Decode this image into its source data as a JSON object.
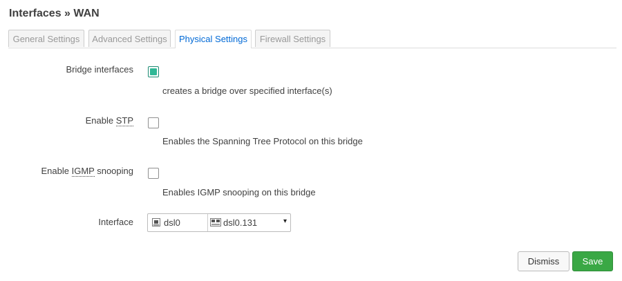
{
  "page": {
    "title": "Interfaces » WAN"
  },
  "tabs": [
    {
      "label": "General Settings",
      "active": false
    },
    {
      "label": "Advanced Settings",
      "active": false
    },
    {
      "label": "Physical Settings",
      "active": true
    },
    {
      "label": "Firewall Settings",
      "active": false
    }
  ],
  "fields": {
    "bridge": {
      "label": "Bridge interfaces",
      "checked": true,
      "description": "creates a bridge over specified interface(s)"
    },
    "stp": {
      "label_prefix": "Enable ",
      "label_abbr": "STP",
      "label_suffix": "",
      "checked": false,
      "description": "Enables the Spanning Tree Protocol on this bridge"
    },
    "igmp": {
      "label_prefix": "Enable ",
      "label_abbr": "IGMP",
      "label_suffix": " snooping",
      "checked": false,
      "description": "Enables IGMP snooping on this bridge"
    },
    "interface": {
      "label": "Interface",
      "selected": [
        "dsl0",
        "dsl0.131"
      ],
      "dropdown_glyph": "▾"
    }
  },
  "buttons": {
    "dismiss": "Dismiss",
    "save": "Save"
  },
  "colors": {
    "accent": "#0069d6",
    "checked": "#30b896",
    "save": "#3aa845"
  }
}
